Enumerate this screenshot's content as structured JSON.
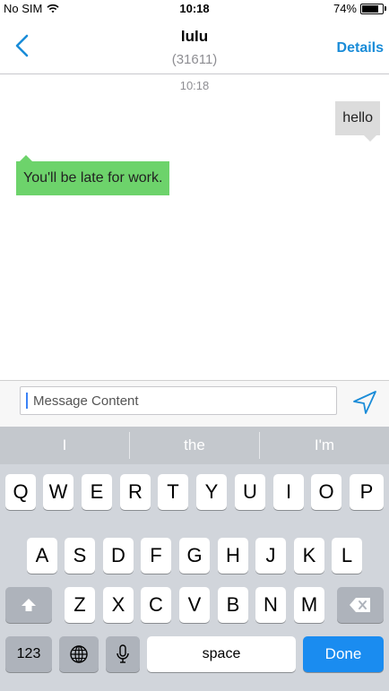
{
  "status": {
    "carrier": "No SIM",
    "time": "10:18",
    "battery": "74%",
    "battery_level": 0.74
  },
  "nav": {
    "contact_name": "lulu",
    "contact_number": "(31611)",
    "details_label": "Details"
  },
  "conversation": {
    "timestamp": "10:18",
    "messages": [
      {
        "direction": "outgoing",
        "text": "hello"
      },
      {
        "direction": "incoming",
        "text": "You'll be late for work."
      }
    ]
  },
  "compose": {
    "placeholder": "Message Content"
  },
  "keyboard": {
    "suggestions": [
      "I",
      "the",
      "I'm"
    ],
    "row1": [
      "Q",
      "W",
      "E",
      "R",
      "T",
      "Y",
      "U",
      "I",
      "O",
      "P"
    ],
    "row2": [
      "A",
      "S",
      "D",
      "F",
      "G",
      "H",
      "J",
      "K",
      "L"
    ],
    "row3": [
      "Z",
      "X",
      "C",
      "V",
      "B",
      "N",
      "M"
    ],
    "numbers_label": "123",
    "space_label": "space",
    "done_label": "Done"
  },
  "colors": {
    "accent": "#1a8cd8",
    "incoming_bubble": "#6dd36b",
    "outgoing_bubble": "#dcdcdc",
    "done_key": "#1a8cf0"
  },
  "icons": [
    "wifi-icon",
    "battery-icon",
    "back-chevron-icon",
    "send-icon",
    "shift-icon",
    "backspace-icon",
    "globe-icon",
    "microphone-icon"
  ]
}
